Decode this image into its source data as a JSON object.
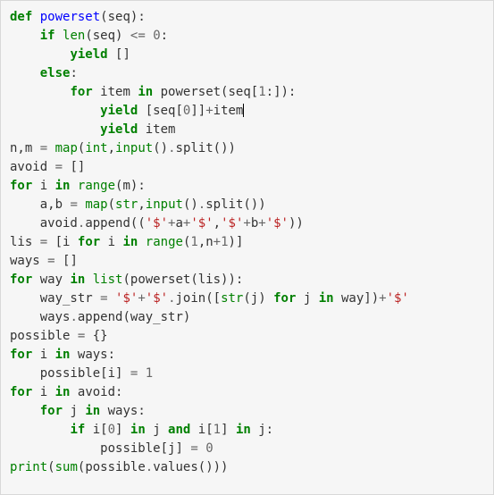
{
  "code": {
    "language": "python",
    "tokens": [
      {
        "line": 1,
        "indent": 0,
        "parts": [
          {
            "t": "kw",
            "v": "def"
          },
          {
            "t": "sp",
            "v": " "
          },
          {
            "t": "fn",
            "v": "powerset"
          },
          {
            "t": "txt",
            "v": "(seq):"
          }
        ]
      },
      {
        "line": 2,
        "indent": 1,
        "parts": [
          {
            "t": "kw",
            "v": "if"
          },
          {
            "t": "sp",
            "v": " "
          },
          {
            "t": "bi",
            "v": "len"
          },
          {
            "t": "txt",
            "v": "(seq) "
          },
          {
            "t": "op",
            "v": "<="
          },
          {
            "t": "sp",
            "v": " "
          },
          {
            "t": "num",
            "v": "0"
          },
          {
            "t": "txt",
            "v": ":"
          }
        ]
      },
      {
        "line": 3,
        "indent": 2,
        "parts": [
          {
            "t": "kw",
            "v": "yield"
          },
          {
            "t": "sp",
            "v": " "
          },
          {
            "t": "txt",
            "v": "[]"
          }
        ]
      },
      {
        "line": 4,
        "indent": 1,
        "parts": [
          {
            "t": "kw",
            "v": "else"
          },
          {
            "t": "txt",
            "v": ":"
          }
        ]
      },
      {
        "line": 5,
        "indent": 2,
        "parts": [
          {
            "t": "kw",
            "v": "for"
          },
          {
            "t": "sp",
            "v": " "
          },
          {
            "t": "txt",
            "v": "item "
          },
          {
            "t": "kw",
            "v": "in"
          },
          {
            "t": "sp",
            "v": " "
          },
          {
            "t": "txt",
            "v": "powerset(seq["
          },
          {
            "t": "num",
            "v": "1"
          },
          {
            "t": "txt",
            "v": ":]):"
          }
        ]
      },
      {
        "line": 6,
        "indent": 3,
        "parts": [
          {
            "t": "kw",
            "v": "yield"
          },
          {
            "t": "sp",
            "v": " "
          },
          {
            "t": "txt",
            "v": "[seq["
          },
          {
            "t": "num",
            "v": "0"
          },
          {
            "t": "txt",
            "v": "]]"
          },
          {
            "t": "op",
            "v": "+"
          },
          {
            "t": "txt",
            "v": "item"
          },
          {
            "t": "cursor",
            "v": ""
          }
        ]
      },
      {
        "line": 7,
        "indent": 3,
        "parts": [
          {
            "t": "kw",
            "v": "yield"
          },
          {
            "t": "sp",
            "v": " "
          },
          {
            "t": "txt",
            "v": "item"
          }
        ]
      },
      {
        "line": 8,
        "indent": 0,
        "parts": [
          {
            "t": "txt",
            "v": "n,m "
          },
          {
            "t": "op",
            "v": "="
          },
          {
            "t": "sp",
            "v": " "
          },
          {
            "t": "bi",
            "v": "map"
          },
          {
            "t": "txt",
            "v": "("
          },
          {
            "t": "bi",
            "v": "int"
          },
          {
            "t": "txt",
            "v": ","
          },
          {
            "t": "bi",
            "v": "input"
          },
          {
            "t": "txt",
            "v": "()"
          },
          {
            "t": "op",
            "v": "."
          },
          {
            "t": "txt",
            "v": "split())"
          }
        ]
      },
      {
        "line": 9,
        "indent": 0,
        "parts": [
          {
            "t": "txt",
            "v": "avoid "
          },
          {
            "t": "op",
            "v": "="
          },
          {
            "t": "sp",
            "v": " "
          },
          {
            "t": "txt",
            "v": "[]"
          }
        ]
      },
      {
        "line": 10,
        "indent": 0,
        "parts": [
          {
            "t": "kw",
            "v": "for"
          },
          {
            "t": "sp",
            "v": " "
          },
          {
            "t": "txt",
            "v": "i "
          },
          {
            "t": "kw",
            "v": "in"
          },
          {
            "t": "sp",
            "v": " "
          },
          {
            "t": "bi",
            "v": "range"
          },
          {
            "t": "txt",
            "v": "(m):"
          }
        ]
      },
      {
        "line": 11,
        "indent": 1,
        "parts": [
          {
            "t": "txt",
            "v": "a,b "
          },
          {
            "t": "op",
            "v": "="
          },
          {
            "t": "sp",
            "v": " "
          },
          {
            "t": "bi",
            "v": "map"
          },
          {
            "t": "txt",
            "v": "("
          },
          {
            "t": "bi",
            "v": "str"
          },
          {
            "t": "txt",
            "v": ","
          },
          {
            "t": "bi",
            "v": "input"
          },
          {
            "t": "txt",
            "v": "()"
          },
          {
            "t": "op",
            "v": "."
          },
          {
            "t": "txt",
            "v": "split())"
          }
        ]
      },
      {
        "line": 12,
        "indent": 1,
        "parts": [
          {
            "t": "txt",
            "v": "avoid"
          },
          {
            "t": "op",
            "v": "."
          },
          {
            "t": "txt",
            "v": "append(("
          },
          {
            "t": "str",
            "v": "'$'"
          },
          {
            "t": "op",
            "v": "+"
          },
          {
            "t": "txt",
            "v": "a"
          },
          {
            "t": "op",
            "v": "+"
          },
          {
            "t": "str",
            "v": "'$'"
          },
          {
            "t": "txt",
            "v": ","
          },
          {
            "t": "str",
            "v": "'$'"
          },
          {
            "t": "op",
            "v": "+"
          },
          {
            "t": "txt",
            "v": "b"
          },
          {
            "t": "op",
            "v": "+"
          },
          {
            "t": "str",
            "v": "'$'"
          },
          {
            "t": "txt",
            "v": "))"
          }
        ]
      },
      {
        "line": 13,
        "indent": 0,
        "parts": [
          {
            "t": "txt",
            "v": "lis "
          },
          {
            "t": "op",
            "v": "="
          },
          {
            "t": "sp",
            "v": " "
          },
          {
            "t": "txt",
            "v": "[i "
          },
          {
            "t": "kw",
            "v": "for"
          },
          {
            "t": "sp",
            "v": " "
          },
          {
            "t": "txt",
            "v": "i "
          },
          {
            "t": "kw",
            "v": "in"
          },
          {
            "t": "sp",
            "v": " "
          },
          {
            "t": "bi",
            "v": "range"
          },
          {
            "t": "txt",
            "v": "("
          },
          {
            "t": "num",
            "v": "1"
          },
          {
            "t": "txt",
            "v": ",n"
          },
          {
            "t": "op",
            "v": "+"
          },
          {
            "t": "num",
            "v": "1"
          },
          {
            "t": "txt",
            "v": ")]"
          }
        ]
      },
      {
        "line": 14,
        "indent": 0,
        "parts": [
          {
            "t": "txt",
            "v": "ways "
          },
          {
            "t": "op",
            "v": "="
          },
          {
            "t": "sp",
            "v": " "
          },
          {
            "t": "txt",
            "v": "[]"
          }
        ]
      },
      {
        "line": 15,
        "indent": 0,
        "parts": [
          {
            "t": "kw",
            "v": "for"
          },
          {
            "t": "sp",
            "v": " "
          },
          {
            "t": "txt",
            "v": "way "
          },
          {
            "t": "kw",
            "v": "in"
          },
          {
            "t": "sp",
            "v": " "
          },
          {
            "t": "bi",
            "v": "list"
          },
          {
            "t": "txt",
            "v": "(powerset(lis)):"
          }
        ]
      },
      {
        "line": 16,
        "indent": 1,
        "parts": [
          {
            "t": "txt",
            "v": "way_str "
          },
          {
            "t": "op",
            "v": "="
          },
          {
            "t": "sp",
            "v": " "
          },
          {
            "t": "str",
            "v": "'$'"
          },
          {
            "t": "op",
            "v": "+"
          },
          {
            "t": "str",
            "v": "'$'"
          },
          {
            "t": "op",
            "v": "."
          },
          {
            "t": "txt",
            "v": "join(["
          },
          {
            "t": "bi",
            "v": "str"
          },
          {
            "t": "txt",
            "v": "(j) "
          },
          {
            "t": "kw",
            "v": "for"
          },
          {
            "t": "sp",
            "v": " "
          },
          {
            "t": "txt",
            "v": "j "
          },
          {
            "t": "kw",
            "v": "in"
          },
          {
            "t": "sp",
            "v": " "
          },
          {
            "t": "txt",
            "v": "way])"
          },
          {
            "t": "op",
            "v": "+"
          },
          {
            "t": "str",
            "v": "'$'"
          }
        ]
      },
      {
        "line": 17,
        "indent": 1,
        "parts": [
          {
            "t": "txt",
            "v": "ways"
          },
          {
            "t": "op",
            "v": "."
          },
          {
            "t": "txt",
            "v": "append(way_str)"
          }
        ]
      },
      {
        "line": 18,
        "indent": 0,
        "parts": [
          {
            "t": "txt",
            "v": "possible "
          },
          {
            "t": "op",
            "v": "="
          },
          {
            "t": "sp",
            "v": " "
          },
          {
            "t": "txt",
            "v": "{}"
          }
        ]
      },
      {
        "line": 19,
        "indent": 0,
        "parts": [
          {
            "t": "kw",
            "v": "for"
          },
          {
            "t": "sp",
            "v": " "
          },
          {
            "t": "txt",
            "v": "i "
          },
          {
            "t": "kw",
            "v": "in"
          },
          {
            "t": "sp",
            "v": " "
          },
          {
            "t": "txt",
            "v": "ways:"
          }
        ]
      },
      {
        "line": 20,
        "indent": 1,
        "parts": [
          {
            "t": "txt",
            "v": "possible[i] "
          },
          {
            "t": "op",
            "v": "="
          },
          {
            "t": "sp",
            "v": " "
          },
          {
            "t": "num",
            "v": "1"
          }
        ]
      },
      {
        "line": 21,
        "indent": 0,
        "parts": [
          {
            "t": "kw",
            "v": "for"
          },
          {
            "t": "sp",
            "v": " "
          },
          {
            "t": "txt",
            "v": "i "
          },
          {
            "t": "kw",
            "v": "in"
          },
          {
            "t": "sp",
            "v": " "
          },
          {
            "t": "txt",
            "v": "avoid:"
          }
        ]
      },
      {
        "line": 22,
        "indent": 1,
        "parts": [
          {
            "t": "kw",
            "v": "for"
          },
          {
            "t": "sp",
            "v": " "
          },
          {
            "t": "txt",
            "v": "j "
          },
          {
            "t": "kw",
            "v": "in"
          },
          {
            "t": "sp",
            "v": " "
          },
          {
            "t": "txt",
            "v": "ways:"
          }
        ]
      },
      {
        "line": 23,
        "indent": 2,
        "parts": [
          {
            "t": "kw",
            "v": "if"
          },
          {
            "t": "sp",
            "v": " "
          },
          {
            "t": "txt",
            "v": "i["
          },
          {
            "t": "num",
            "v": "0"
          },
          {
            "t": "txt",
            "v": "] "
          },
          {
            "t": "kw",
            "v": "in"
          },
          {
            "t": "sp",
            "v": " "
          },
          {
            "t": "txt",
            "v": "j "
          },
          {
            "t": "kw",
            "v": "and"
          },
          {
            "t": "sp",
            "v": " "
          },
          {
            "t": "txt",
            "v": "i["
          },
          {
            "t": "num",
            "v": "1"
          },
          {
            "t": "txt",
            "v": "] "
          },
          {
            "t": "kw",
            "v": "in"
          },
          {
            "t": "sp",
            "v": " "
          },
          {
            "t": "txt",
            "v": "j:"
          }
        ]
      },
      {
        "line": 24,
        "indent": 3,
        "parts": [
          {
            "t": "txt",
            "v": "possible[j] "
          },
          {
            "t": "op",
            "v": "="
          },
          {
            "t": "sp",
            "v": " "
          },
          {
            "t": "num",
            "v": "0"
          }
        ]
      },
      {
        "line": 25,
        "indent": 0,
        "parts": [
          {
            "t": "bi",
            "v": "print"
          },
          {
            "t": "txt",
            "v": "("
          },
          {
            "t": "bi",
            "v": "sum"
          },
          {
            "t": "txt",
            "v": "(possible"
          },
          {
            "t": "op",
            "v": "."
          },
          {
            "t": "txt",
            "v": "values()))"
          }
        ]
      }
    ]
  }
}
